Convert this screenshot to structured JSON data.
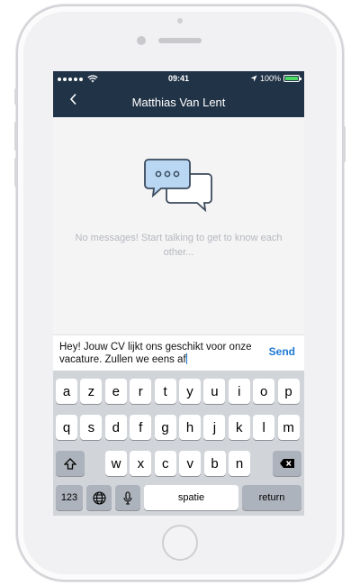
{
  "status_bar": {
    "time": "09:41",
    "battery_percent": "100%",
    "battery_level": 1.0,
    "battery_color": "#4cd964"
  },
  "nav": {
    "back_icon": "chevron-left-icon",
    "title": "Matthias Van Lent",
    "color": "#213347"
  },
  "empty_state": {
    "icon": "chat-bubbles-icon",
    "message": "No messages! Start talking to get to know each other..."
  },
  "composer": {
    "text": "Hey! Jouw CV lijkt ons geschikt voor onze vacature. Zullen we eens af",
    "send_label": "Send",
    "accent": "#1c78d4"
  },
  "keyboard": {
    "row1": [
      "a",
      "z",
      "e",
      "r",
      "t",
      "y",
      "u",
      "i",
      "o",
      "p"
    ],
    "row2": [
      "q",
      "s",
      "d",
      "f",
      "g",
      "h",
      "j",
      "k",
      "l",
      "m"
    ],
    "row3": [
      "w",
      "x",
      "c",
      "v",
      "b",
      "n"
    ],
    "shift_icon": "shift-icon",
    "delete_icon": "backspace-icon",
    "numbers_label": "123",
    "globe_icon": "globe-icon",
    "mic_icon": "microphone-icon",
    "space_label": "spatie",
    "return_label": "return"
  }
}
